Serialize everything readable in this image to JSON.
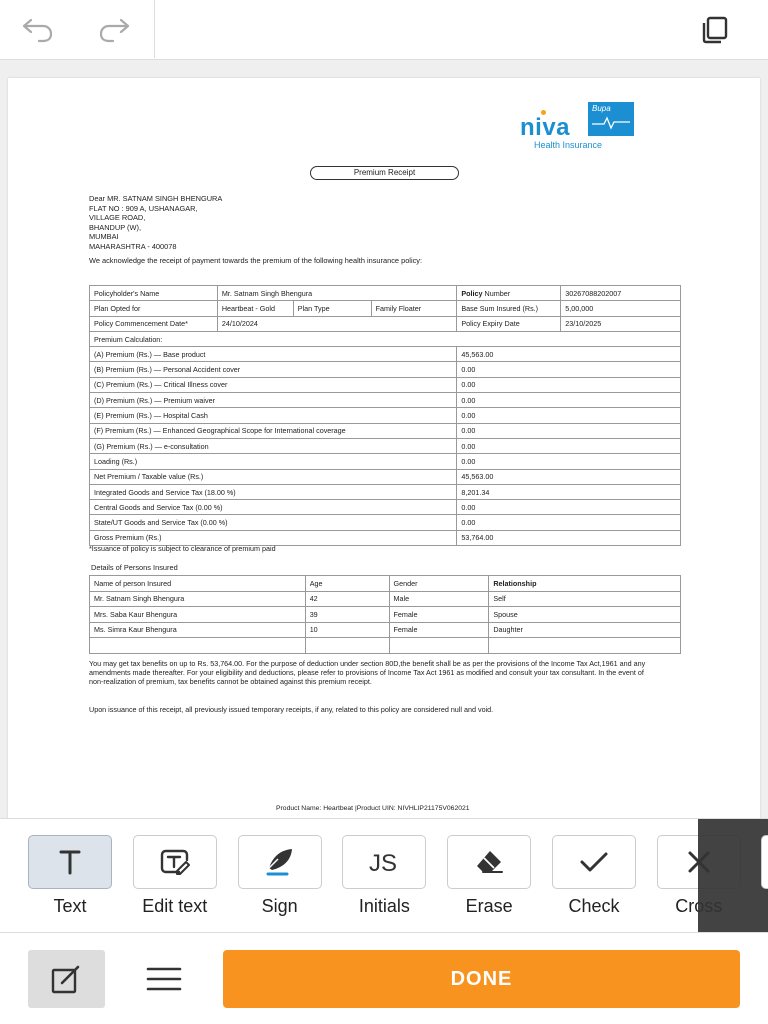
{
  "toolbar": {
    "undo_icon": "undo-arrow-icon",
    "redo_icon": "redo-arrow-icon",
    "pages_icon": "copy-pages-icon"
  },
  "document": {
    "logo": {
      "brand": "niva",
      "partner": "Bupa",
      "tagline": "Health Insurance"
    },
    "receipt_title": "Premium Receipt",
    "address": [
      "Dear MR. SATNAM SINGH BHENGURA",
      "FLAT NO : 909 A, USHANAGAR,",
      "VILLAGE ROAD,",
      "BHANDUP (W),",
      "MUMBAI",
      "MAHARASHTRA - 400078"
    ],
    "acknowledgement": "We acknowledge the receipt of payment towards the premium of the following health insurance policy:",
    "policy": {
      "holder_label": "Policyholder's Name",
      "holder_value": "Mr. Satnam Singh Bhengura",
      "number_label_bold": "Policy",
      "number_label_rest": " Number",
      "number_value": "30267088202007",
      "plan_label": "Plan Opted for",
      "plan_value": "Heartbeat - Gold",
      "plan_type_label": "Plan Type",
      "plan_type_value": "Family Floater",
      "sum_label": "Base Sum Insured (Rs.)",
      "sum_value": "5,00,000",
      "commencement_label": "Policy Commencement Date*",
      "commencement_value": "24/10/2024",
      "expiry_label": "Policy Expiry Date",
      "expiry_value": "23/10/2025",
      "calc_label": "Premium Calculation:"
    },
    "premium_rows": [
      {
        "label": "(A) Premium (Rs.) — Base product",
        "value": "45,563.00"
      },
      {
        "label": "(B) Premium (Rs.) — Personal Accident cover",
        "value": "0.00"
      },
      {
        "label": "(C) Premium (Rs.) — Critical Illness cover",
        "value": "0.00"
      },
      {
        "label": "(D) Premium (Rs.) — Premium waiver",
        "value": "0.00"
      },
      {
        "label": "(E) Premium (Rs.) — Hospital Cash",
        "value": "0.00"
      },
      {
        "label": "(F) Premium (Rs.) — Enhanced Geographical Scope for International coverage",
        "value": "0.00"
      },
      {
        "label": "(G) Premium (Rs.) — e-consultation",
        "value": "0.00"
      },
      {
        "label": "Loading (Rs.)",
        "value": "0.00"
      },
      {
        "label": "Net Premium / Taxable value (Rs.)",
        "value": "45,563.00"
      },
      {
        "label": "Integrated Goods and Service Tax (18.00 %)",
        "value": "8,201.34"
      },
      {
        "label": "Central Goods and Service Tax (0.00 %)",
        "value": "0.00"
      },
      {
        "label": "State/UT Goods and Service Tax (0.00 %)",
        "value": "0.00"
      },
      {
        "label": "Gross Premium (Rs.)",
        "value": "53,764.00"
      }
    ],
    "note": "*Issuance of policy is subject to clearance of premium paid",
    "persons_title": "Details of Persons Insured",
    "persons_headers": [
      "Name of person Insured",
      "Age",
      "Gender",
      "Relationship"
    ],
    "persons": [
      {
        "name": "Mr. Satnam Singh Bhengura",
        "age": "42",
        "gender": "Male",
        "relationship": "Self"
      },
      {
        "name": "Mrs. Saba Kaur Bhengura",
        "age": "39",
        "gender": "Female",
        "relationship": "Spouse"
      },
      {
        "name": "Ms. Simra Kaur Bhengura",
        "age": "10",
        "gender": "Female",
        "relationship": "Daughter"
      }
    ],
    "tax_text": "You may get tax benefits on up to Rs. 53,764.00. For the purpose of deduction under section 80D,the benefit shall be as per the provisions of the Income Tax Act,1961 and any amendments made thereafter. For your eligibility and deductions, please refer to provisions of Income Tax Act 1961 as modified and consult your tax consultant. In the event of non-realization of premium, tax benefits cannot be obtained against this premium receipt.",
    "upon_text": "Upon issuance of this receipt, all previously issued temporary receipts, if any, related to this policy are considered null and void.",
    "footer": "Product Name: Heartbeat |Product UIN: NIVHLIP21175V062021"
  },
  "tools": [
    {
      "label": "Text",
      "icon": "text-t-icon",
      "active": true
    },
    {
      "label": "Edit text",
      "icon": "edit-text-icon",
      "active": false
    },
    {
      "label": "Sign",
      "icon": "pen-nib-icon",
      "active": false
    },
    {
      "label": "Initials",
      "icon": "initials-js-icon",
      "active": false
    },
    {
      "label": "Erase",
      "icon": "eraser-icon",
      "active": false
    },
    {
      "label": "Check",
      "icon": "checkmark-icon",
      "active": false
    },
    {
      "label": "Cross",
      "icon": "cross-icon",
      "active": false
    }
  ],
  "bottom": {
    "done_label": "DONE"
  },
  "colors": {
    "accent": "#f7931e",
    "brand_blue": "#1b8fd1",
    "active_tool_bg": "#dde3ea"
  }
}
